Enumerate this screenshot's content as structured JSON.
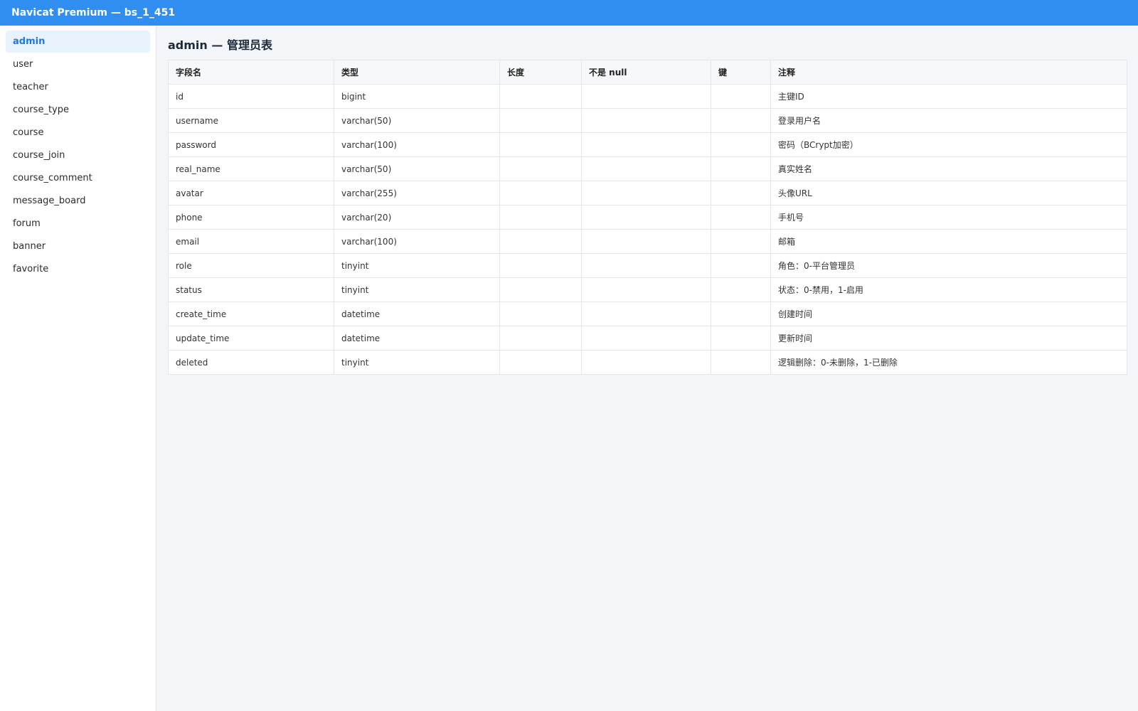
{
  "window": {
    "title": "Navicat Premium — bs_1_451"
  },
  "sidebar": {
    "items": [
      {
        "label": "admin",
        "active": true
      },
      {
        "label": "user"
      },
      {
        "label": "teacher"
      },
      {
        "label": "course_type"
      },
      {
        "label": "course"
      },
      {
        "label": "course_join"
      },
      {
        "label": "course_comment"
      },
      {
        "label": "message_board"
      },
      {
        "label": "forum"
      },
      {
        "label": "banner"
      },
      {
        "label": "favorite"
      }
    ]
  },
  "main": {
    "title": "admin — 管理员表",
    "columns": [
      "字段名",
      "类型",
      "长度",
      "不是 null",
      "键",
      "注释"
    ],
    "rows": [
      [
        "id",
        "bigint",
        "",
        "",
        "",
        "主键ID"
      ],
      [
        "username",
        "varchar(50)",
        "",
        "",
        "",
        "登录用户名"
      ],
      [
        "password",
        "varchar(100)",
        "",
        "",
        "",
        "密码（BCrypt加密）"
      ],
      [
        "real_name",
        "varchar(50)",
        "",
        "",
        "",
        "真实姓名"
      ],
      [
        "avatar",
        "varchar(255)",
        "",
        "",
        "",
        "头像URL"
      ],
      [
        "phone",
        "varchar(20)",
        "",
        "",
        "",
        "手机号"
      ],
      [
        "email",
        "varchar(100)",
        "",
        "",
        "",
        "邮箱"
      ],
      [
        "role",
        "tinyint",
        "",
        "",
        "",
        "角色：0-平台管理员"
      ],
      [
        "status",
        "tinyint",
        "",
        "",
        "",
        "状态：0-禁用，1-启用"
      ],
      [
        "create_time",
        "datetime",
        "",
        "",
        "",
        "创建时间"
      ],
      [
        "update_time",
        "datetime",
        "",
        "",
        "",
        "更新时间"
      ],
      [
        "deleted",
        "tinyint",
        "",
        "",
        "",
        "逻辑删除：0-未删除，1-已删除"
      ]
    ]
  },
  "colors": {
    "titlebar": "#2f8ef0",
    "accent": "#1f7ae0",
    "active_bg": "#e8f2fd"
  }
}
